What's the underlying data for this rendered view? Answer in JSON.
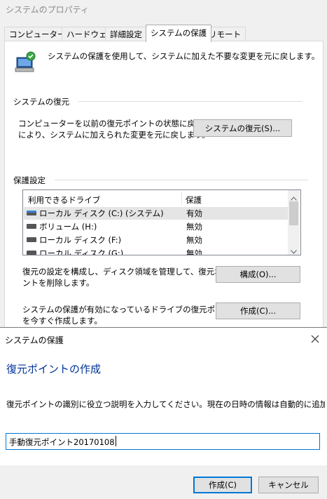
{
  "properties_window": {
    "title": "システムのプロパティ",
    "tabs": [
      {
        "label": "コンピューター名"
      },
      {
        "label": "ハードウェア"
      },
      {
        "label": "詳細設定"
      },
      {
        "label": "システムの保護"
      },
      {
        "label": "リモート"
      }
    ],
    "active_tab": "システムの保護",
    "intro_text": "システムの保護を使用して、システムに加えた不要な変更を元に戻します。",
    "restore_group": {
      "heading": "システムの復元",
      "description_line1": "コンピューターを以前の復元ポイントの状態に戻すこと",
      "description_line2": "により、システムに加えられた変更を元に戻します。",
      "button_label": "システムの復元(S)..."
    },
    "protection_group": {
      "heading": "保護設定",
      "columns": {
        "drive": "利用できるドライブ",
        "protection": "保護"
      },
      "drives": [
        {
          "name": "ローカル ディスク (C:) (システム)",
          "protection": "有効",
          "icon": "system-drive-icon"
        },
        {
          "name": "ボリューム (H:)",
          "protection": "無効",
          "icon": "drive-icon"
        },
        {
          "name": "ローカル ディスク (F:)",
          "protection": "無効",
          "icon": "drive-icon"
        },
        {
          "name": "ローカル ディスク (G:)",
          "protection": "無効",
          "icon": "drive-icon"
        }
      ],
      "configure_text_line1": "復元の設定を構成し、ディスク領域を管理して、復元ポイ",
      "configure_text_line2": "ントを削除します。",
      "configure_button": "構成(O)...",
      "create_text_line1": "システムの保護が有効になっているドライブの復元ポイント",
      "create_text_line2": "を今すぐ作成します。",
      "create_button": "作成(C)..."
    }
  },
  "dialog": {
    "title": "システムの保護",
    "heading": "復元ポイントの作成",
    "instruction": "復元ポイントの識別に役立つ説明を入力してください。現在の日時の情報は自動的に追加されます。",
    "input_value": "手動復元ポイント20170108",
    "create_button": "作成(C)",
    "cancel_button": "キャンセル"
  },
  "colors": {
    "heading_blue": "#003399",
    "focus_blue": "#0078d7"
  }
}
